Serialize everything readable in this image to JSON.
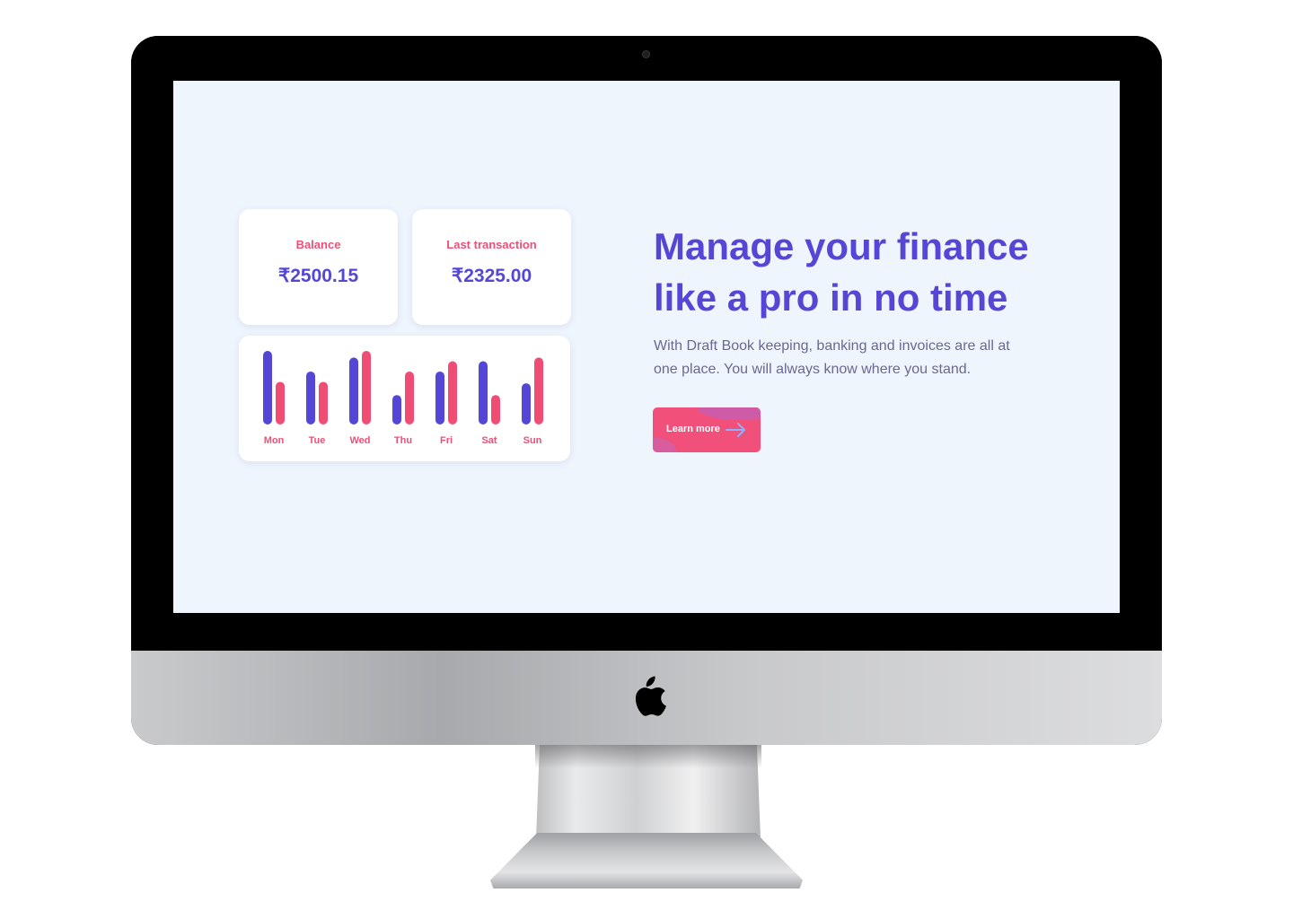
{
  "stats": {
    "balance": {
      "label": "Balance",
      "value": "₹2500.15"
    },
    "last_transaction": {
      "label": "Last transaction",
      "value": "₹2325.00"
    }
  },
  "hero": {
    "headline_line1": "Manage your finance",
    "headline_line2": "like a pro in no time",
    "description_line1": "With Draft Book keeping, banking and invoices are all at",
    "description_line2": "one place. You will always know where you stand.",
    "cta_label": "Learn more"
  },
  "colors": {
    "series_a": "#5447d6",
    "series_b": "#f04d74",
    "day_label": "#ef4f77",
    "screen_bg": "#eff5fd"
  },
  "icons": {
    "cta_arrow": "arrow-right-icon",
    "logo": "apple-logo-icon",
    "camera": "camera-icon"
  },
  "chart_data": {
    "type": "bar",
    "categories": [
      "Mon",
      "Tue",
      "Wed",
      "Thu",
      "Fri",
      "Sat",
      "Sun"
    ],
    "series": [
      {
        "values": [
          100,
          72,
          91,
          40,
          72,
          86,
          56
        ]
      },
      {
        "values": [
          58,
          58,
          100,
          72,
          86,
          40,
          91
        ]
      }
    ],
    "ylim": [
      0,
      100
    ],
    "grid": false,
    "legend": "none"
  }
}
